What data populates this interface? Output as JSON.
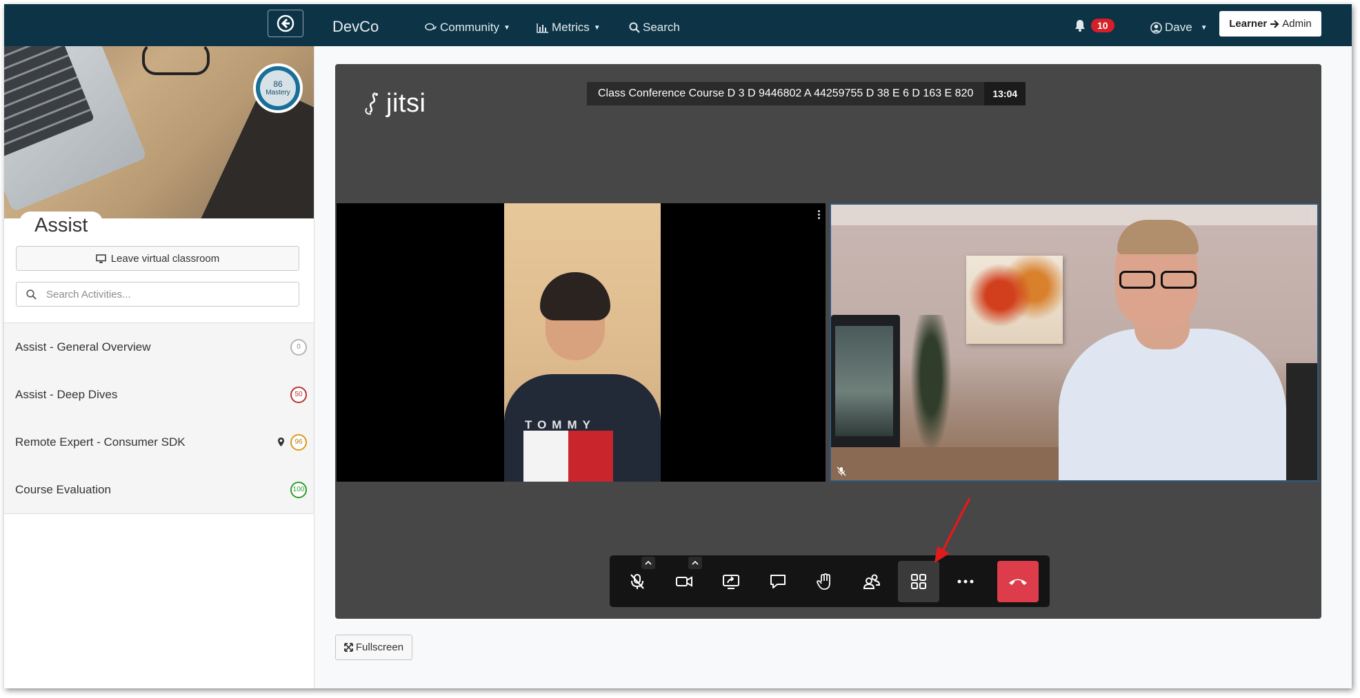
{
  "navbar": {
    "brand": "DevCo",
    "items": [
      {
        "label": "Community",
        "icon": "chat-icon"
      },
      {
        "label": "Metrics",
        "icon": "bar-chart-icon"
      },
      {
        "label": "Search",
        "icon": "search-icon"
      }
    ],
    "notifications_count": "10",
    "user_name": "Dave",
    "role_from": "Learner",
    "role_to": "Admin"
  },
  "sidebar": {
    "mastery_value": "86",
    "mastery_label": "Mastery",
    "title": "Assist",
    "leave_label": "Leave virtual classroom",
    "search_placeholder": "Search Activities...",
    "activities": [
      {
        "label": "Assist - General Overview",
        "score": "0",
        "score_color": "#b5b5b5"
      },
      {
        "label": "Assist - Deep Dives",
        "score": "50",
        "score_color": "#b83232"
      },
      {
        "label": "Remote Expert - Consumer SDK",
        "score": "96",
        "score_color": "#d99a1c",
        "pinned": true
      },
      {
        "label": "Course Evaluation",
        "score": "100",
        "score_color": "#2d9c2d"
      }
    ]
  },
  "conference": {
    "logo_text": "jitsi",
    "title": "Class Conference Course D 3 D 9446802 A 44259755 D 38 E 6 D 163 E 820",
    "timer": "13:04",
    "shirt_text": "TOMMY",
    "toolbar": [
      "microphone-muted-icon",
      "camera-icon",
      "share-screen-icon",
      "chat-bubble-icon",
      "raise-hand-icon",
      "participants-icon",
      "tile-view-icon",
      "more-icon",
      "hangup-icon"
    ]
  },
  "fullscreen_label": "Fullscreen",
  "colors": {
    "navbar": "#0d3446",
    "stage": "#474747",
    "hangup": "#dd3d4b",
    "badge": "#d61f26"
  }
}
